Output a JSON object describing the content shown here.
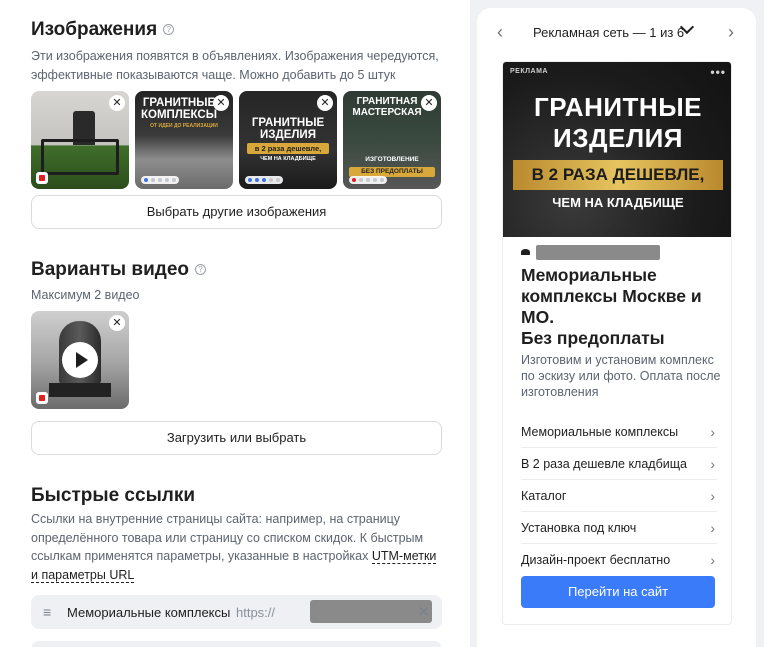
{
  "images_section": {
    "title": "Изображения",
    "description": "Эти изображения появятся в объявлениях. Изображения чередуются, эффективные показываются чаще. Можно добавить до 5 штук",
    "thumbs": [
      {
        "caption": ""
      },
      {
        "caption": "ГРАНИТНЫЕ КОМПЛЕКСЫ",
        "sub": "ОТ ИДЕИ ДО РЕАЛИЗАЦИИ"
      },
      {
        "caption": "ГРАНИТНЫЕ ИЗДЕЛИЯ",
        "strip": "в 2 раза дешевле,",
        "sub": "ЧЕМ НА КЛАДБИЩЕ"
      },
      {
        "caption": "ГРАНИТНАЯ МАСТЕРСКАЯ",
        "sub": "ИЗГОТОВЛЕНИЕ",
        "strip": "БЕЗ ПРЕДОПЛАТЫ"
      }
    ],
    "choose_button": "Выбрать другие изображения"
  },
  "video_section": {
    "title": "Варианты видео",
    "description": "Максимум 2 видео",
    "upload_button": "Загрузить или выбрать"
  },
  "quicklinks_section": {
    "title": "Быстрые ссылки",
    "description_start": "Ссылки на внутренние страницы сайта: например, на страницу определённого товара или страницу со списком скидок. К быстрым ссылкам применятся параметры, указанные в настройках ",
    "description_link": "UTM-метки и параметры URL",
    "row": {
      "label": "Мемориальные комплексы",
      "url_prefix": "https://"
    }
  },
  "preview": {
    "nav_label": "Рекламная сеть — 1 из 6",
    "ad_badge": "РЕКЛАМА",
    "image_headline_1": "ГРАНИТНЫЕ",
    "image_headline_2": "ИЗДЕЛИЯ",
    "image_gold": "В 2 РАЗА ДЕШЕВЛЕ,",
    "image_sub": "ЧЕМ НА КЛАДБИЩЕ",
    "title_1": "Мемориальные комплексы Москве и МО.",
    "title_2": "Без предоплаты",
    "text": "Изготовим и установим комплекс по эскизу или фото. Оплата после изготовления",
    "quick_links": [
      "Мемориальные комплексы",
      "В 2 раза дешевле кладбища",
      "Каталог",
      "Установка под ключ",
      "Дизайн-проект бесплатно"
    ],
    "cta": "Перейти на сайт"
  },
  "colors": {
    "accent": "#3a7bfa",
    "background": "#f0f1f4"
  }
}
